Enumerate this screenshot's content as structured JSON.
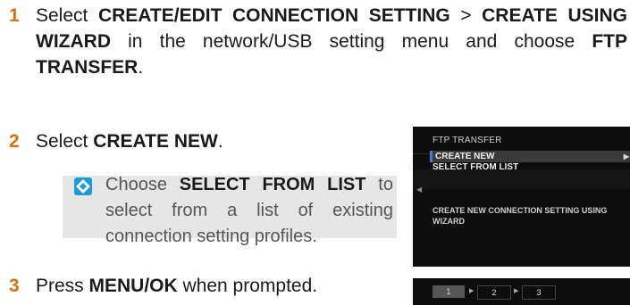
{
  "steps": [
    {
      "num": "1",
      "parts": [
        {
          "t": "Select ",
          "b": false
        },
        {
          "t": "CREATE/EDIT CONNECTION SETTING",
          "b": true
        },
        {
          "t": " > ",
          "b": false
        },
        {
          "t": "CREATE USING WIZARD",
          "b": true
        },
        {
          "t": " in the network/USB setting menu and choose ",
          "b": false
        },
        {
          "t": "FTP TRANSFER",
          "b": true
        },
        {
          "t": ".",
          "b": false
        }
      ]
    },
    {
      "num": "2",
      "parts": [
        {
          "t": "Select ",
          "b": false
        },
        {
          "t": "CREATE NEW",
          "b": true
        },
        {
          "t": ".",
          "b": false
        }
      ]
    },
    {
      "num": "3",
      "parts": [
        {
          "t": "Press ",
          "b": false
        },
        {
          "t": "MENU/OK",
          "b": true
        },
        {
          "t": " when prompted.",
          "b": false
        }
      ]
    }
  ],
  "note": {
    "parts": [
      {
        "t": "Choose ",
        "b": false
      },
      {
        "t": "SELECT FROM LIST",
        "b": true
      },
      {
        "t": " to select from a list of existing connection setting profiles.",
        "b": false
      }
    ]
  },
  "screen1": {
    "title": "FTP TRANSFER",
    "items": [
      "CREATE NEW",
      "SELECT FROM LIST"
    ],
    "description": "CREATE NEW CONNECTION SETTING USING WIZARD"
  },
  "screen2": {
    "steps": [
      "1",
      "2",
      "3"
    ]
  },
  "colors": {
    "step_number": "#d8720e",
    "selection_bar": "#3a7bd5",
    "note_background": "#e6e6e6"
  }
}
